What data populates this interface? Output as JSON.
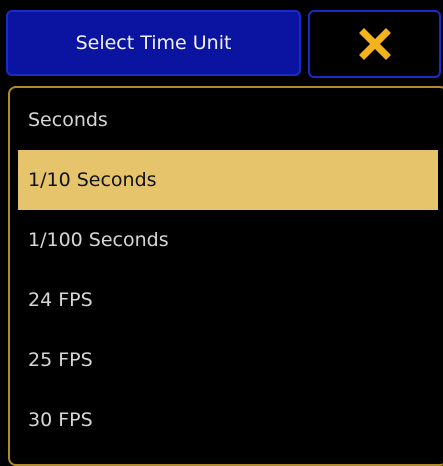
{
  "header": {
    "title": "Select Time Unit",
    "close_icon": "close-icon"
  },
  "list": {
    "selected_index": 1,
    "items": [
      {
        "label": "Seconds"
      },
      {
        "label": "1/10 Seconds"
      },
      {
        "label": "1/100 Seconds"
      },
      {
        "label": "24 FPS"
      },
      {
        "label": "25 FPS"
      },
      {
        "label": "30 FPS"
      }
    ]
  },
  "colors": {
    "title_bg": "#0a14a0",
    "border_blue": "#1a2cc8",
    "panel_border": "#b08a2c",
    "selected_bg": "#e6c46c",
    "close_icon": "#f4b21e"
  }
}
